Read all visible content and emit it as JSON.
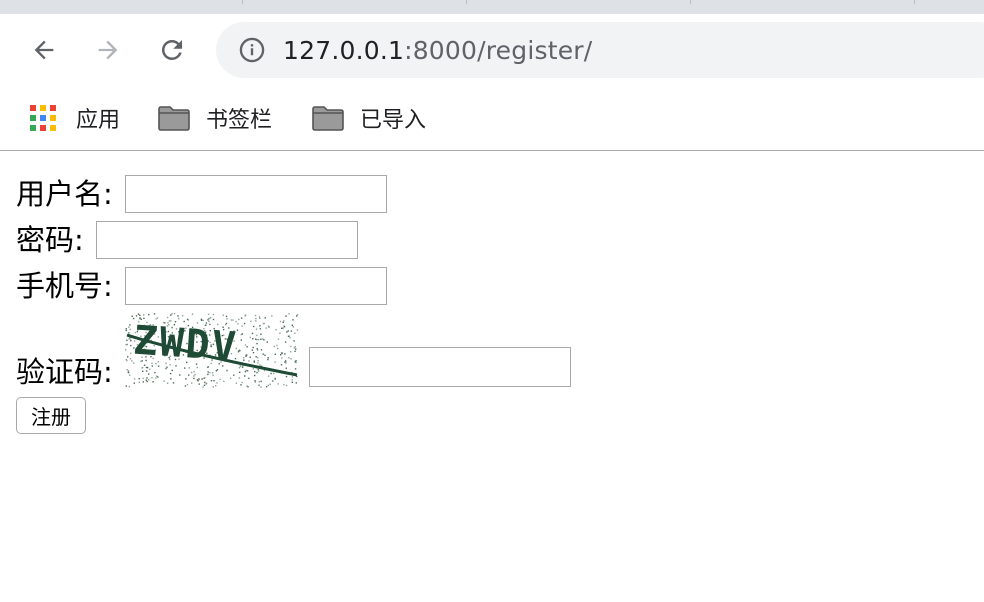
{
  "browser": {
    "url_host": "127.0.0.1",
    "url_rest": ":8000/register/",
    "icons": {
      "back": "back-arrow-icon",
      "forward": "forward-arrow-icon",
      "reload": "reload-icon",
      "info": "info-icon"
    },
    "bookmarks": [
      {
        "label": "应用",
        "icon": "apps-grid-icon"
      },
      {
        "label": "书签栏",
        "icon": "folder-icon"
      },
      {
        "label": "已导入",
        "icon": "folder-icon"
      }
    ]
  },
  "form": {
    "username_label": "用户名:",
    "username_value": "",
    "password_label": "密码:",
    "password_value": "",
    "phone_label": "手机号:",
    "phone_value": "",
    "captcha_label": "验证码:",
    "captcha_text": "ZWDV",
    "captcha_value": "",
    "submit_label": "注册"
  },
  "colors": {
    "apps_grid": [
      "#ea4335",
      "#fbbc04",
      "#ea4335",
      "#34a853",
      "#4285f4",
      "#fbbc04",
      "#34a853",
      "#ea4335",
      "#fbbc04"
    ],
    "captcha_ink": "#1f4a35"
  }
}
